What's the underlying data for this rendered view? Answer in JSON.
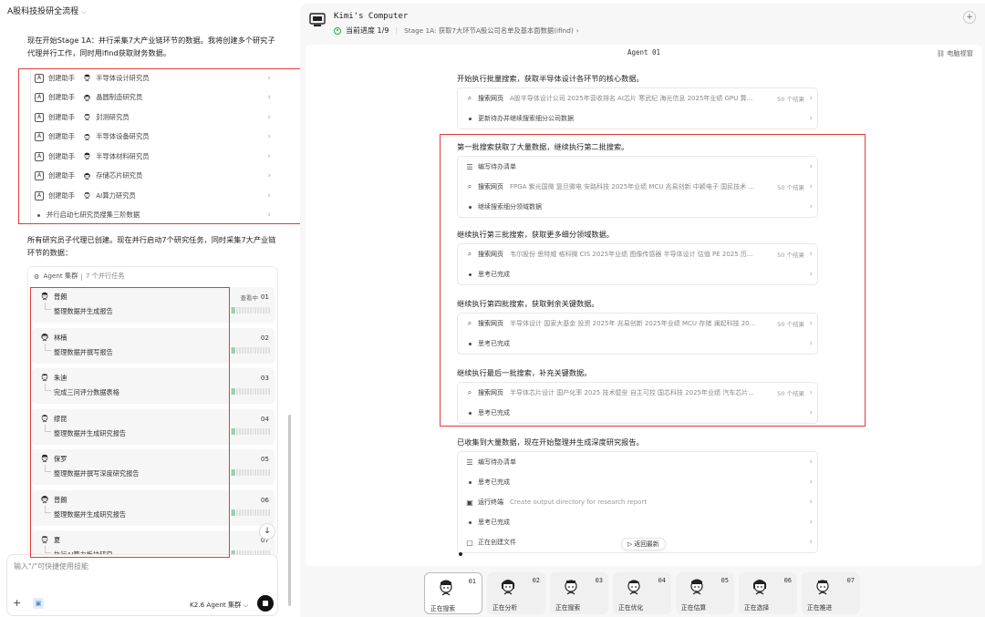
{
  "left": {
    "project_title": "A股科技投研全流程",
    "msg1": "现在开始Stage 1A：并行采集7大产业链环节的数据。我将创建多个研究子代理并行工作，同时用ifind获取财务数据。",
    "helpers": [
      {
        "action": "创建助手",
        "name": "半导体设计研究员"
      },
      {
        "action": "创建助手",
        "name": "晶圆制造研究员"
      },
      {
        "action": "创建助手",
        "name": "封测研究员"
      },
      {
        "action": "创建助手",
        "name": "半导体设备研究员"
      },
      {
        "action": "创建助手",
        "name": "半导体材料研究员"
      },
      {
        "action": "创建助手",
        "name": "存储芯片研究员"
      },
      {
        "action": "创建助手",
        "name": "AI算力研究员"
      }
    ],
    "helper_last": "并行启动七研究员搜集三阶数据",
    "msg2": "所有研究员子代理已创建。现在并行启动7个研究任务，同时采集7大产业链环节的数据：",
    "cluster": {
      "title": "Agent 集群",
      "count": "7 个并行任务",
      "agents": [
        {
          "name": "普朗",
          "task": "整理数据并生成报告",
          "status": "查看中",
          "num": "01"
        },
        {
          "name": "林楠",
          "task": "整理数据并撰写报告",
          "status": "",
          "num": "02"
        },
        {
          "name": "朱迪",
          "task": "完成三问评分数据表格",
          "status": "",
          "num": "03"
        },
        {
          "name": "缪昆",
          "task": "整理数据并生成研究报告",
          "status": "",
          "num": "04"
        },
        {
          "name": "保罗",
          "task": "整理数据并撰写深度研究报告",
          "status": "",
          "num": "05"
        },
        {
          "name": "普朗",
          "task": "整理数据并生成研究报告",
          "status": "",
          "num": "06"
        },
        {
          "name": "夏",
          "task": "执行AI算力板块研究",
          "status": "",
          "num": "07"
        }
      ]
    },
    "input_placeholder": "输入\"/\"可快捷使用技能",
    "model_label": "K2.6 Agent 集群"
  },
  "right": {
    "title": "Kimi's Computer",
    "progress_label": "当前进度 1/9",
    "stage_label": "Stage 1A: 获取7大环节A股公司名单及基本面数据(ifind)",
    "agent_header": "Agent 01",
    "view_label": "电脑视窗",
    "sections": [
      {
        "title": "开始执行批量搜索，获取半导体设计各环节的核心数据。",
        "rows": [
          {
            "kind": "search",
            "label": "搜索网页",
            "query": "A股半导体设计公司 2025年营收排名 AI芯片 寒武纪 海光信息 2025年业绩 GPU 算...",
            "count": "50 个结果"
          },
          {
            "kind": "dot",
            "label": "更新待办并继续搜索细分公司数据"
          }
        ]
      },
      {
        "title": "第一批搜索获取了大量数据，继续执行第二批搜索。",
        "rows": [
          {
            "kind": "list",
            "label": "编写待办清单"
          },
          {
            "kind": "search",
            "label": "搜索网页",
            "query": "FPGA 紫光国微 复旦微电 安路科技 2025年业绩 MCU 兆易创新 中颖电子 国民技术 ...",
            "count": "50 个结果"
          },
          {
            "kind": "dot",
            "label": "继续搜索细分领域数据"
          }
        ]
      },
      {
        "title": "继续执行第三批搜索，获取更多细分领域数据。",
        "rows": [
          {
            "kind": "search",
            "label": "搜索网页",
            "query": "韦尔股份 思特威 格科微 CIS 2025年业绩 图像传感器 半导体设计 估值 PE 2025 历...",
            "count": "50 个结果"
          },
          {
            "kind": "dot",
            "label": "思考已完成"
          }
        ]
      },
      {
        "title": "继续执行第四批搜索，获取剩余关键数据。",
        "rows": [
          {
            "kind": "search",
            "label": "搜索网页",
            "query": "半导体设计 国家大基金 投资 2025年 兆易创新 2025年业绩 MCU 存储 澜起科技 20...",
            "count": "50 个结果"
          },
          {
            "kind": "dot",
            "label": "思考已完成"
          }
        ]
      },
      {
        "title": "继续执行最后一批搜索，补充关键数据。",
        "rows": [
          {
            "kind": "search",
            "label": "搜索网页",
            "query": "半导体芯片设计 国产化率 2025 技术壁垒 自主可控 国芯科技 2025年业绩 汽车芯片...",
            "count": "50 个结果"
          },
          {
            "kind": "dot",
            "label": "思考已完成"
          }
        ]
      },
      {
        "title": "已收集到大量数据，现在开始整理并生成深度研究报告。",
        "rows": [
          {
            "kind": "list",
            "label": "编写待办清单"
          },
          {
            "kind": "dot",
            "label": "思考已完成"
          },
          {
            "kind": "term",
            "label": "运行终端",
            "query": "Create output directory for research report"
          },
          {
            "kind": "dot",
            "label": "思考已完成"
          },
          {
            "kind": "file",
            "label": "正在创建文件"
          }
        ]
      }
    ],
    "back_latest": "返回最新",
    "tray": [
      {
        "num": "01",
        "label": "正在搜索"
      },
      {
        "num": "02",
        "label": "正在分析"
      },
      {
        "num": "03",
        "label": "正在搜索"
      },
      {
        "num": "04",
        "label": "正在优化"
      },
      {
        "num": "05",
        "label": "正在估算"
      },
      {
        "num": "06",
        "label": "正在选择"
      },
      {
        "num": "07",
        "label": "正在推进"
      }
    ]
  }
}
